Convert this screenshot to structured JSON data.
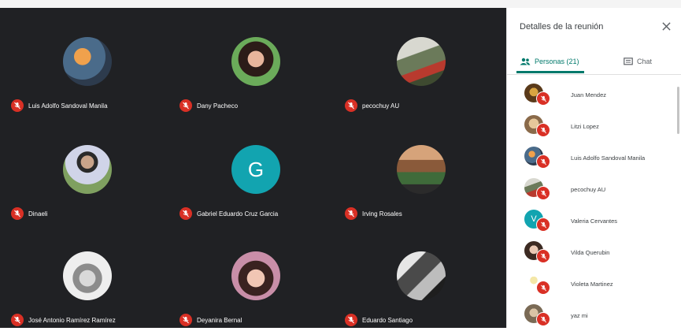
{
  "meeting_grid": {
    "tiles": [
      {
        "name": "Luis Adolfo Sandoval Manila"
      },
      {
        "name": "Dany Pacheco"
      },
      {
        "name": "pecochuy AU"
      },
      {
        "name": "Dinaeli"
      },
      {
        "name": "Gabriel Eduardo Cruz Garcia",
        "initial": "G",
        "color": "#12a4b0"
      },
      {
        "name": "Irving Rosales"
      },
      {
        "name": "José Antonio Ramírez Ramírez"
      },
      {
        "name": "Deyanira Bernal"
      },
      {
        "name": "Eduardo Santiago"
      }
    ]
  },
  "panel": {
    "title": "Detalles de la reunión",
    "tabs": {
      "people": "Personas (21)",
      "chat": "Chat"
    },
    "accent_color": "#00796b",
    "people": [
      {
        "name": "Juan Mendez"
      },
      {
        "name": "Litzi Lopez"
      },
      {
        "name": "Luis Adolfo Sandoval Manila"
      },
      {
        "name": "pecochuy AU"
      },
      {
        "name": "Valeria Cervantes",
        "initial": "V",
        "color": "#12a4b0"
      },
      {
        "name": "Vilda Querubin"
      },
      {
        "name": "Violeta Martinez"
      },
      {
        "name": "yaz mi"
      }
    ]
  },
  "icons": {
    "mic": "mic-off-icon",
    "people": "people-icon",
    "chat": "chat-icon",
    "close": "close-icon"
  }
}
